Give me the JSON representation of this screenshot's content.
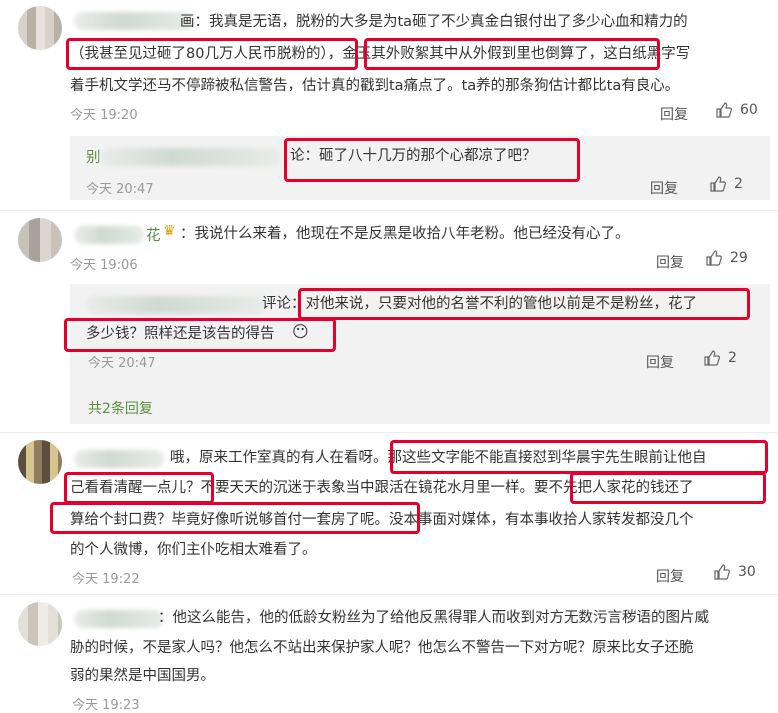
{
  "comments": [
    {
      "lines": [
        "画：我真是无语，脱粉的大多是为ta砸了不少真金白银付出了多少心血和精力的",
        "（我甚至见过砸了80几万人民币脱粉的），金玉其外败絮其中从外假到里也倒算了，这白纸黑字写",
        "着手机文学还马不停蹄被私信警告，估计真的戳到ta痛点了。ta养的那条狗估计都比ta有良心。"
      ],
      "time": "今天 19:20",
      "reply": "回复",
      "likes": "60"
    },
    {
      "sub_prefix": "别",
      "sub_text": "论：砸了八十几万的那个心都凉了吧？",
      "time": "今天 20:47",
      "reply": "回复",
      "likes": "2"
    },
    {
      "name_suffix": "花",
      "badge": "♛",
      "text": "：我说什么来着，他现在不是反黑是收拾八年老粉。他已经没有心了。",
      "time": "今天 19:06",
      "reply": "回复",
      "likes": "29"
    },
    {
      "sub_lines": [
        "评论：对他来说，只要对他的名誉不利的管他以前是不是粉丝，花了",
        "多少钱？照样还是该告的得告"
      ],
      "emoji": "😶",
      "time": "今天 20:47",
      "reply": "回复",
      "likes": "2",
      "more": "共2条回复"
    },
    {
      "lines": [
        "哦，原来工作室真的有人在看呀。那这些文字能不能直接怼到华晨宇先生眼前让他自",
        "己看看清醒一点儿？不要天天的沉迷于表象当中跟活在镜花水月里一样。要不先把人家花的钱还了",
        "算给个封口费？毕竟好像听说够首付一套房了呢。没本事面对媒体，有本事收拾人家转发都没几个",
        "的个人微博，你们主仆吃相太难看了。"
      ],
      "time": "今天 19:22",
      "reply": "回复",
      "likes": "30"
    },
    {
      "lines": [
        "：他这么能告，他的低龄女粉丝为了给他反黑得罪人而收到对方无数污言秽语的图片威",
        "胁的时候，不是家人吗？他怎么不站出来保护家人呢？他怎么不警告一下对方呢？原来比女子还脆",
        "弱的果然是中国国男。"
      ],
      "time": "今天 19:23"
    }
  ]
}
